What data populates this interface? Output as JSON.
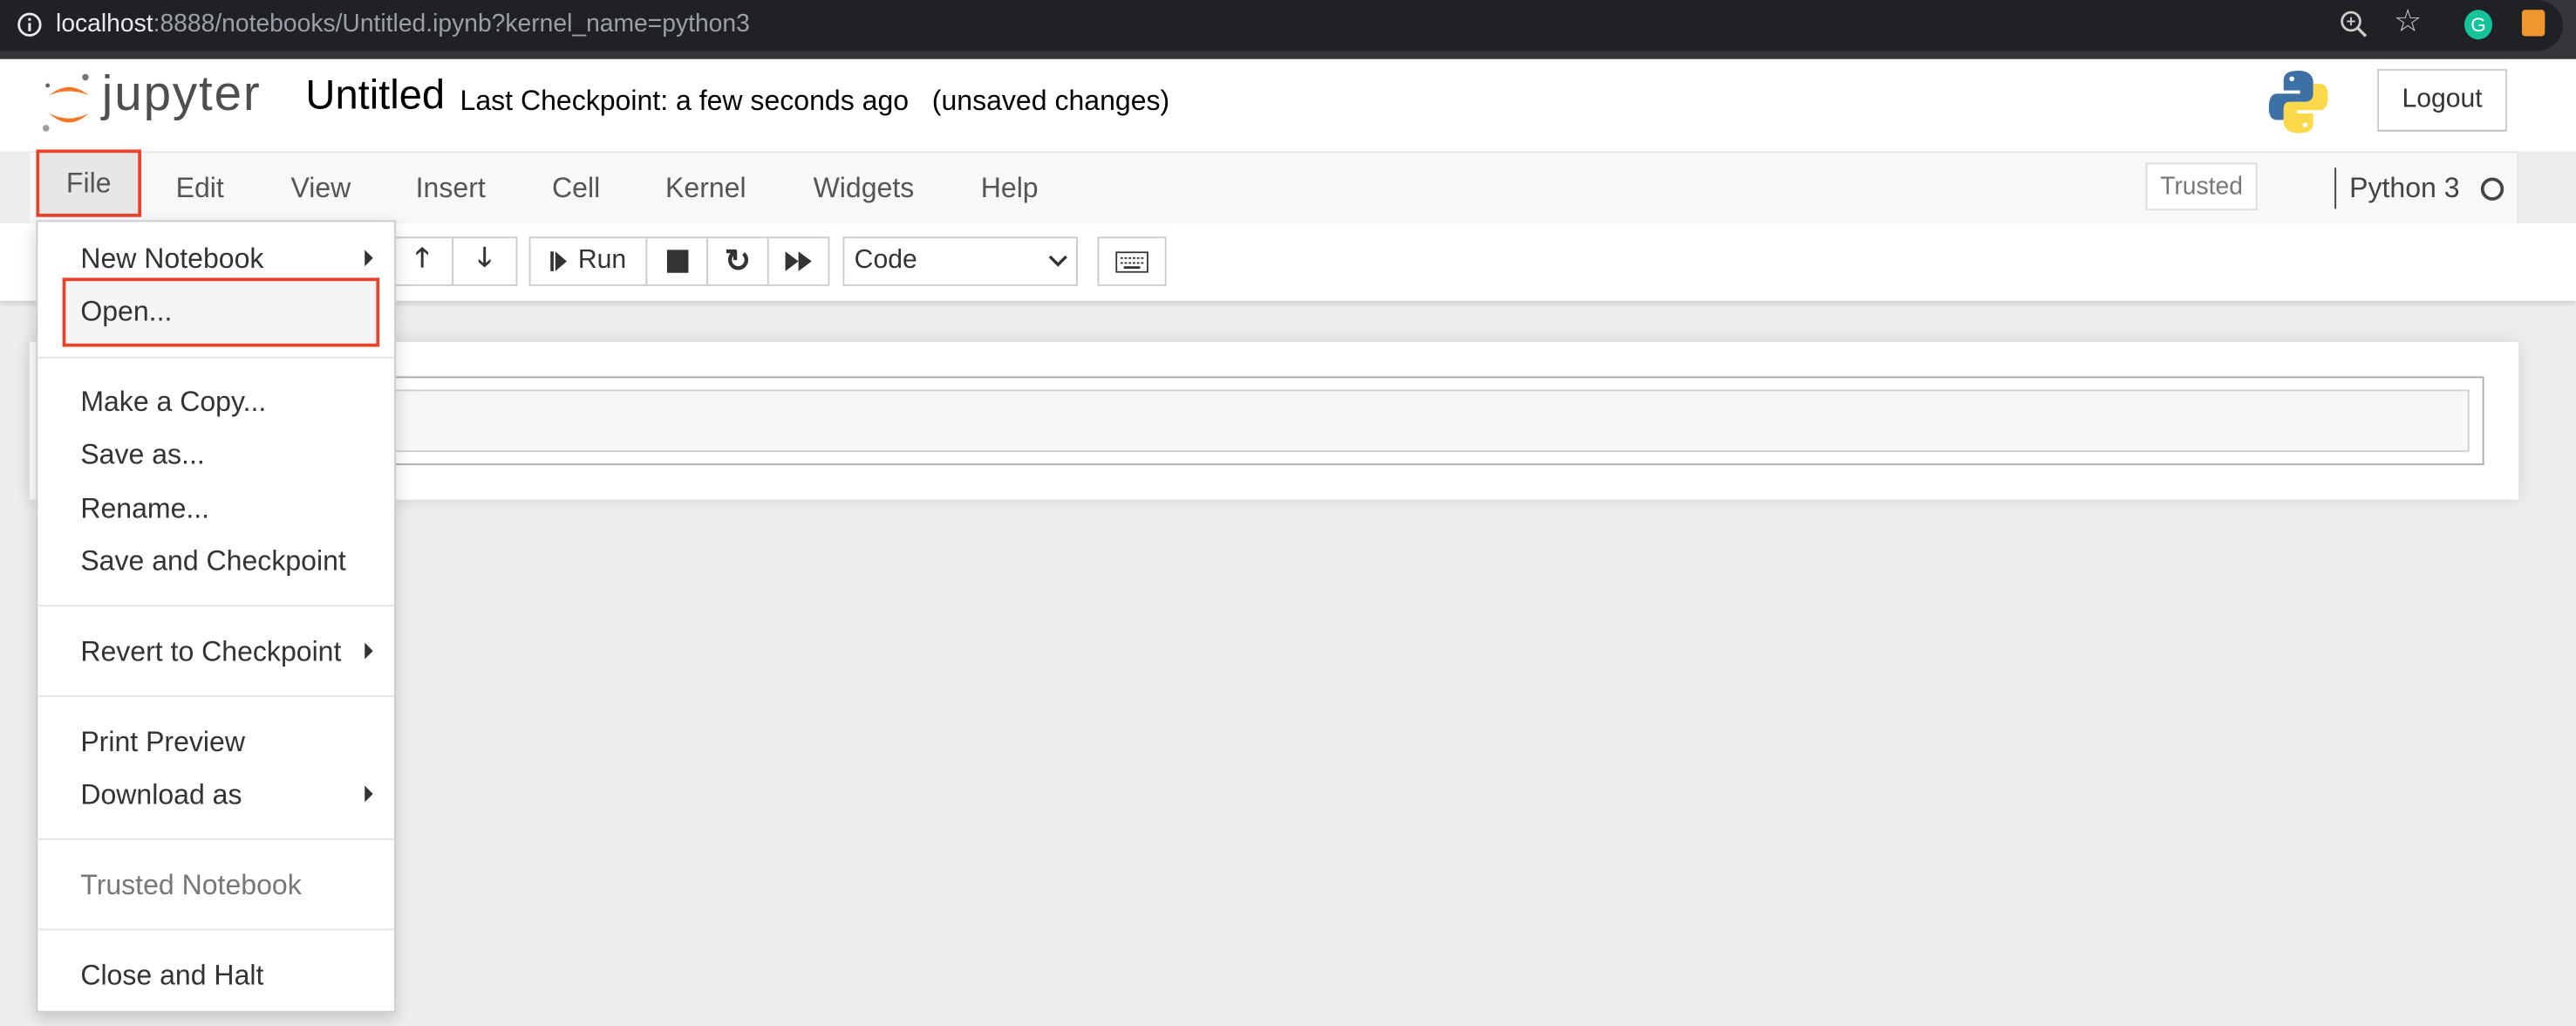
{
  "browser": {
    "url_host": "localhost",
    "url_rest": ":8888/notebooks/Untitled.ipynb?kernel_name=python3",
    "icons": [
      "info-icon",
      "zoom-icon",
      "star-icon",
      "grammarly-icon",
      "extension-icon"
    ]
  },
  "header": {
    "logo_text": "jupyter",
    "notebook_title": "Untitled",
    "checkpoint": "Last Checkpoint: a few seconds ago",
    "unsaved": "(unsaved changes)",
    "logout": "Logout"
  },
  "menubar": {
    "items": [
      "File",
      "Edit",
      "View",
      "Insert",
      "Cell",
      "Kernel",
      "Widgets",
      "Help"
    ],
    "trusted": "Trusted",
    "kernel": "Python 3"
  },
  "toolbar": {
    "run": "Run",
    "cell_type": "Code"
  },
  "file_menu": {
    "items": [
      "New Notebook",
      "Open...",
      "Make a Copy...",
      "Save as...",
      "Rename...",
      "Save and Checkpoint",
      "Revert to Checkpoint",
      "Print Preview",
      "Download as",
      "Trusted Notebook",
      "Close and Halt"
    ],
    "disabled": [
      "Trusted Notebook"
    ]
  },
  "colors": {
    "highlight": "#e8432a",
    "jupyter_orange": "#f37726"
  }
}
